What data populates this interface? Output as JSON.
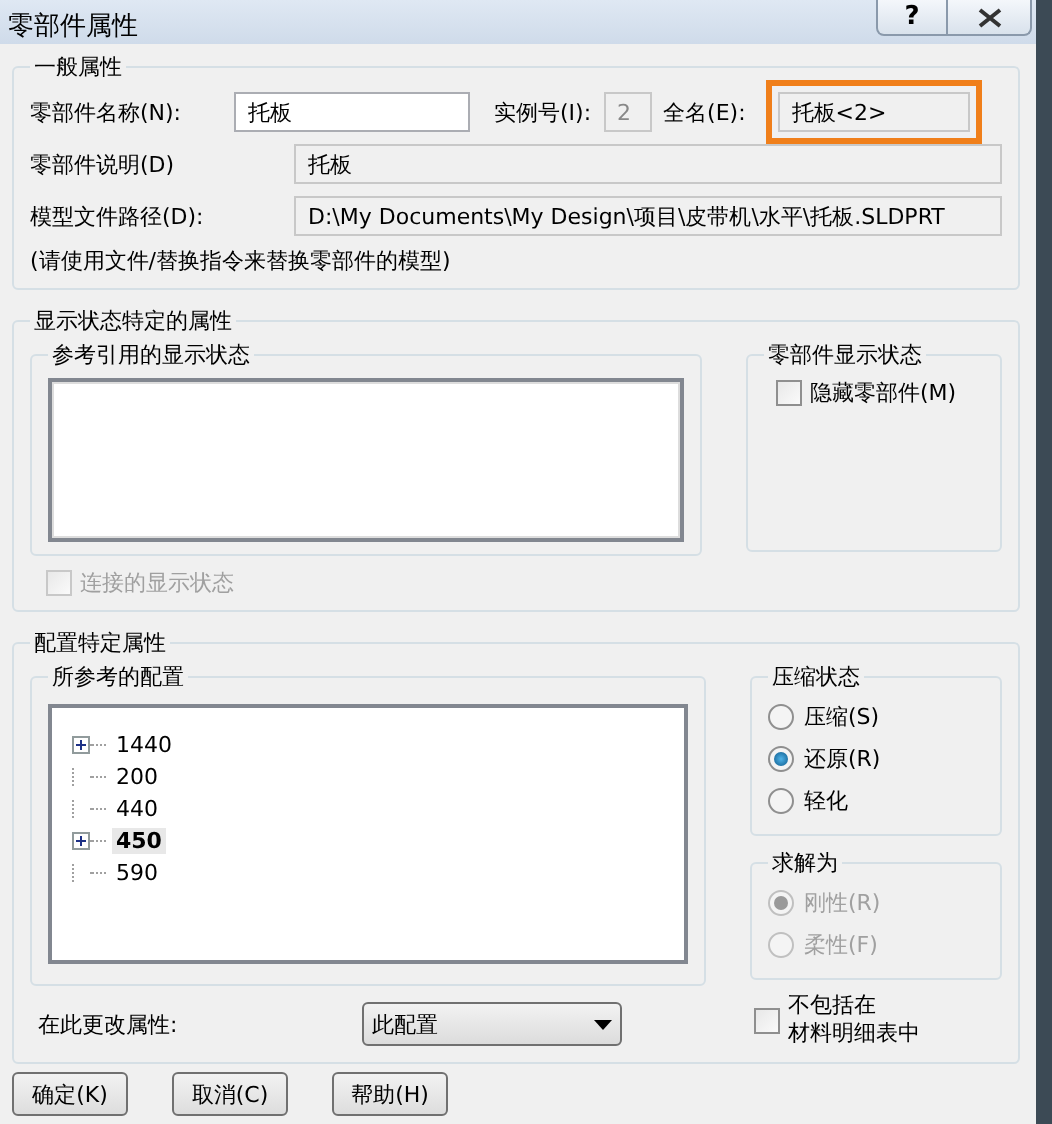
{
  "window": {
    "title": "零部件属性",
    "help_label": "?"
  },
  "general": {
    "title": "一般属性",
    "name_label": "零部件名称(N):",
    "name_value": "托板",
    "instance_label": "实例号(I):",
    "instance_value": "2",
    "fullname_label": "全名(E):",
    "fullname_value": "托板<2>",
    "fullname_highlighted": true,
    "description_label": "零部件说明(D)",
    "description_value": "托板",
    "path_label": "模型文件路径(D):",
    "path_value": "D:\\My Documents\\My Design\\项目\\皮带机\\水平\\托板.SLDPRT",
    "note": "(请使用文件/替换指令来替换零部件的模型)"
  },
  "display": {
    "title": "显示状态特定的属性",
    "ref_title": "参考引用的显示状态",
    "linked": {
      "label": "连接的显示状态",
      "checked": false,
      "disabled": true
    },
    "component_title": "零部件显示状态",
    "hide": {
      "label": "隐藏零部件(M)",
      "checked": false,
      "disabled": false
    }
  },
  "config": {
    "title": "配置特定属性",
    "ref_title": "所参考的配置",
    "tree": [
      {
        "label": "1440",
        "expanded": false,
        "selected": false
      },
      {
        "label": "200",
        "selected": false
      },
      {
        "label": "440",
        "selected": false
      },
      {
        "label": "450",
        "expanded": false,
        "selected": true
      },
      {
        "label": "590",
        "selected": false
      }
    ],
    "change_label": "在此更改属性:",
    "change_value": "此配置",
    "suppression": {
      "title": "压缩状态",
      "options": [
        {
          "label": "压缩(S)",
          "selected": false,
          "disabled": false
        },
        {
          "label": "还原(R)",
          "selected": true,
          "disabled": false
        },
        {
          "label": "轻化",
          "selected": false,
          "disabled": false
        }
      ]
    },
    "solve": {
      "title": "求解为",
      "options": [
        {
          "label": "刚性(R)",
          "selected": true,
          "disabled": true
        },
        {
          "label": "柔性(F)",
          "selected": false,
          "disabled": true
        }
      ]
    },
    "exclude_bom": {
      "lines": [
        "不包括在",
        "材料明细表中"
      ],
      "checked": false,
      "disabled": false
    }
  },
  "buttons": [
    "确定(K)",
    "取消(C)",
    "帮助(H)"
  ]
}
